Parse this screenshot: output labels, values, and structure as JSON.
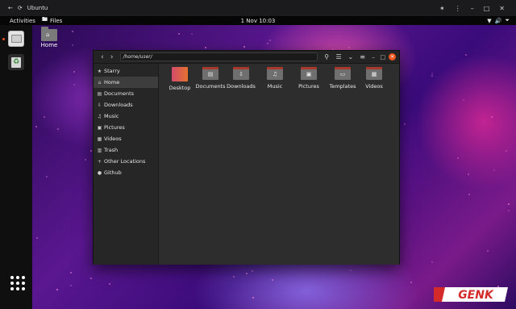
{
  "host": {
    "title": "Ubuntu",
    "back_icon": "arrow-left-icon",
    "reload_icon": "reload-icon",
    "pin_icon": "pin-icon",
    "more_icon": "more-vertical-icon",
    "minimize_icon": "minimize-icon",
    "maximize_icon": "maximize-icon",
    "close_icon": "close-icon"
  },
  "top_panel": {
    "activities": "Activities",
    "app_menu": "Files",
    "clock": "1 Nov 10:03",
    "tray": [
      "network-icon",
      "volume-icon",
      "power-icon"
    ]
  },
  "desktop": {
    "home_label": "Home"
  },
  "files_window": {
    "location": "/home/user/",
    "sidebar": [
      {
        "label": "Starry",
        "icon": "star-icon"
      },
      {
        "label": "Home",
        "icon": "home-icon",
        "active": true
      },
      {
        "label": "Documents",
        "icon": "document-icon"
      },
      {
        "label": "Downloads",
        "icon": "download-icon"
      },
      {
        "label": "Music",
        "icon": "music-icon"
      },
      {
        "label": "Pictures",
        "icon": "picture-icon"
      },
      {
        "label": "Videos",
        "icon": "video-icon"
      },
      {
        "label": "Trash",
        "icon": "trash-icon"
      },
      {
        "label": "Other Locations",
        "icon": "plus-icon"
      },
      {
        "label": "Github",
        "icon": "github-icon"
      }
    ],
    "folders": [
      {
        "label": "Desktop",
        "icon": "desktop-folder-icon"
      },
      {
        "label": "Documents",
        "icon": "documents-folder-icon"
      },
      {
        "label": "Downloads",
        "icon": "downloads-folder-icon"
      },
      {
        "label": "Music",
        "icon": "music-folder-icon"
      },
      {
        "label": "Pictures",
        "icon": "pictures-folder-icon"
      },
      {
        "label": "Templates",
        "icon": "templates-folder-icon"
      },
      {
        "label": "Videos",
        "icon": "videos-folder-icon"
      }
    ]
  },
  "watermark": {
    "text": "GENK",
    "colors": {
      "accent": "#e95420",
      "logo_red": "#d42a2a"
    }
  }
}
